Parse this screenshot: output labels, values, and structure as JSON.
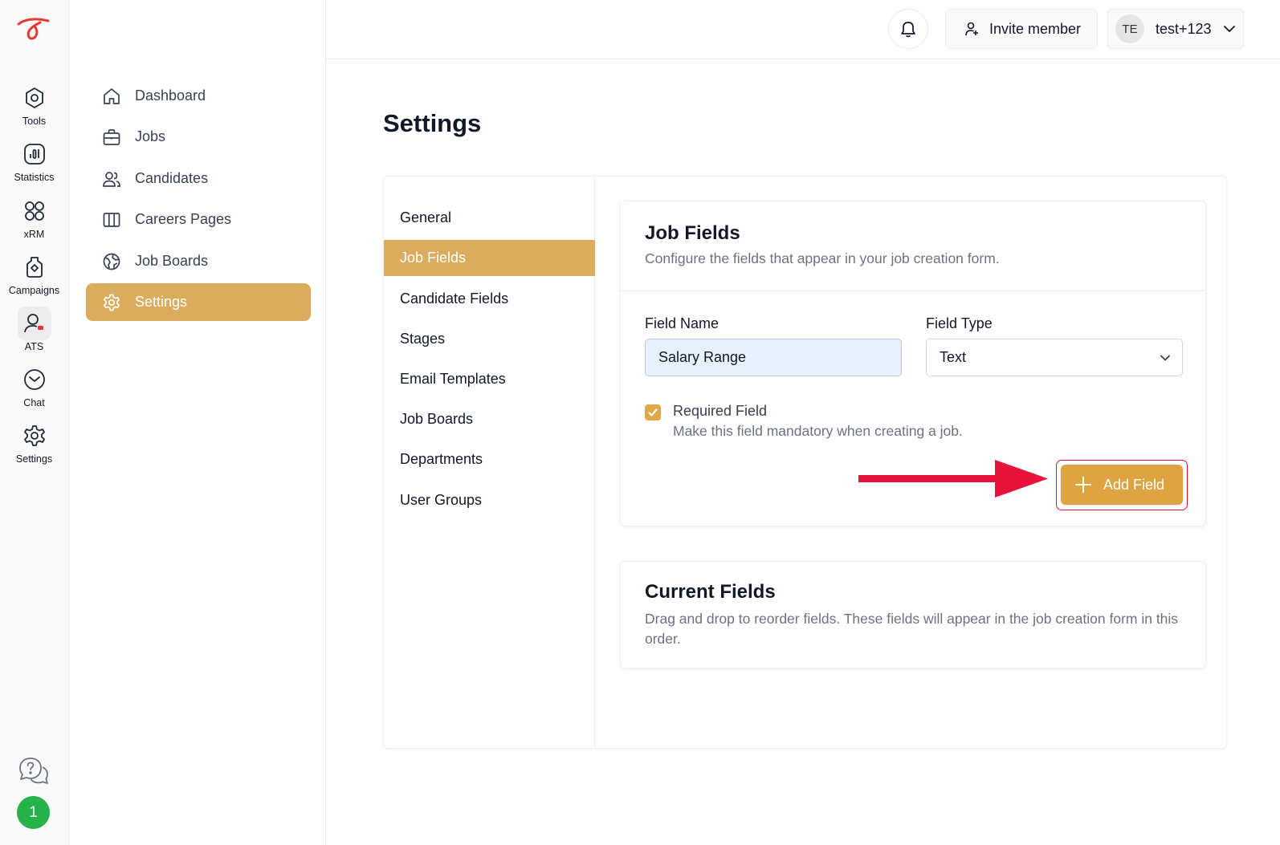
{
  "rail": {
    "items": [
      {
        "label": "Tools",
        "icon": "tools-icon"
      },
      {
        "label": "Statistics",
        "icon": "statistics-icon"
      },
      {
        "label": "xRM",
        "icon": "xrm-icon"
      },
      {
        "label": "Campaigns",
        "icon": "campaigns-icon"
      },
      {
        "label": "ATS",
        "icon": "ats-icon",
        "active": true
      },
      {
        "label": "Chat",
        "icon": "chat-icon"
      },
      {
        "label": "Settings",
        "icon": "settings-icon"
      }
    ],
    "badge": "1"
  },
  "nav": {
    "items": [
      {
        "label": "Dashboard",
        "icon": "home-icon"
      },
      {
        "label": "Jobs",
        "icon": "briefcase-icon"
      },
      {
        "label": "Candidates",
        "icon": "users-icon"
      },
      {
        "label": "Careers Pages",
        "icon": "columns-icon"
      },
      {
        "label": "Job Boards",
        "icon": "globe-icon"
      },
      {
        "label": "Settings",
        "icon": "gear-icon",
        "active": true
      }
    ]
  },
  "header": {
    "invite_label": "Invite member",
    "avatar_initials": "TE",
    "user_name": "test+123"
  },
  "page": {
    "title": "Settings"
  },
  "subnav": {
    "items": [
      "General",
      "Job Fields",
      "Candidate Fields",
      "Stages",
      "Email Templates",
      "Job Boards",
      "Departments",
      "User Groups"
    ],
    "active": "Job Fields"
  },
  "job_fields": {
    "title": "Job Fields",
    "description": "Configure the fields that appear in your job creation form.",
    "field_name_label": "Field Name",
    "field_name_value": "Salary Range",
    "field_type_label": "Field Type",
    "field_type_value": "Text",
    "required_label": "Required Field",
    "required_help": "Make this field mandatory when creating a job.",
    "required_checked": true,
    "add_button": "Add Field"
  },
  "current_fields": {
    "title": "Current Fields",
    "description": "Drag and drop to reorder fields. These fields will appear in the job creation form in this order."
  },
  "colors": {
    "accent": "#dcac5e",
    "button": "#dda441",
    "highlight": "#e0143c",
    "badge": "#25b24a"
  }
}
